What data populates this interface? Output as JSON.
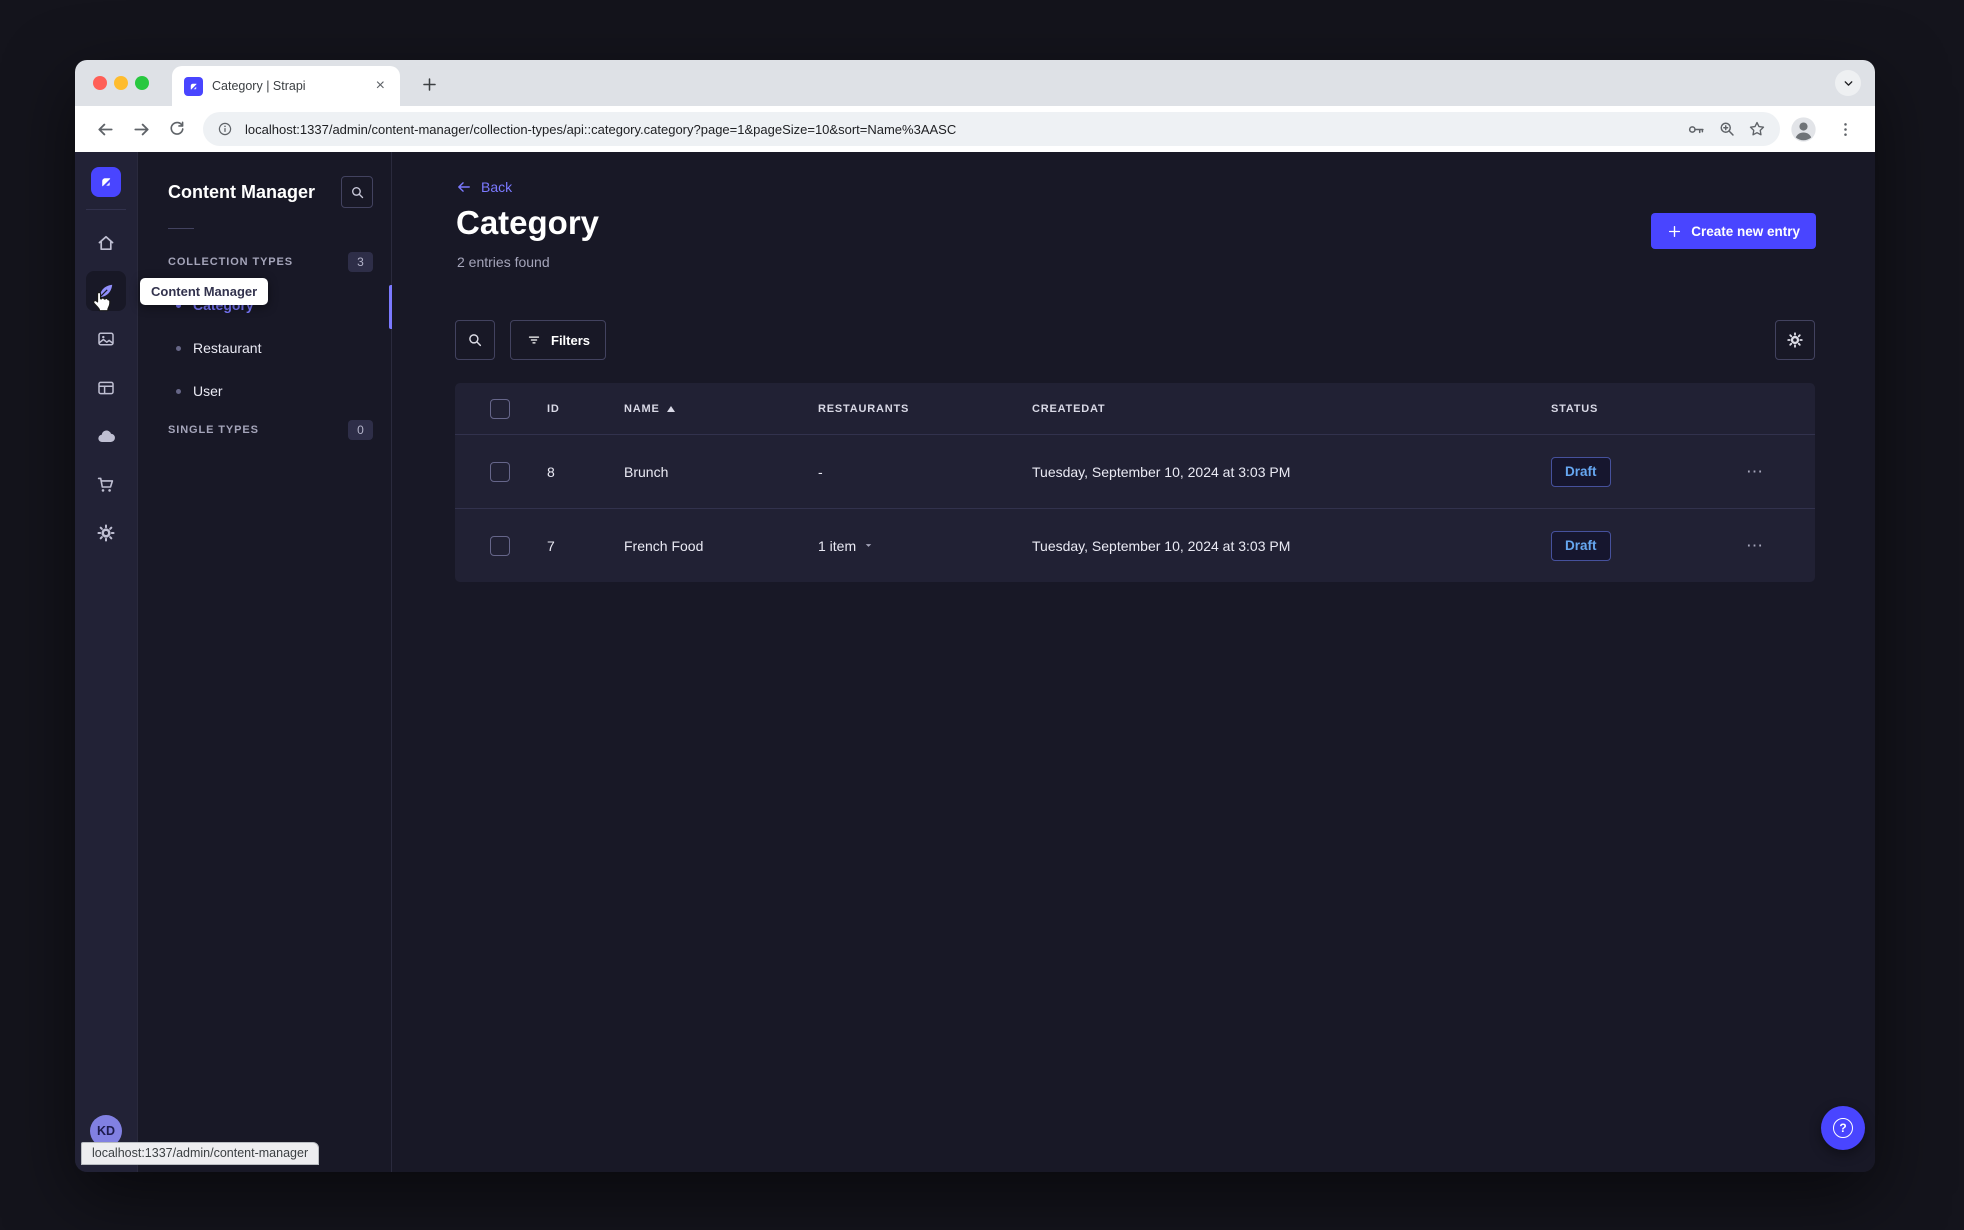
{
  "browser": {
    "tab_title": "Category | Strapi",
    "url": "localhost:1337/admin/content-manager/collection-types/api::category.category?page=1&pageSize=10&sort=Name%3AASC",
    "status_bubble": "localhost:1337/admin/content-manager"
  },
  "icon_rail": {
    "icons": [
      "strapi-logo",
      "home",
      "content-manager",
      "media-library",
      "content-type-builder",
      "cloud",
      "marketplace",
      "settings"
    ],
    "avatar_initials": "KD"
  },
  "subnav": {
    "title": "Content Manager",
    "tooltip": "Content Manager",
    "sections": [
      {
        "label": "COLLECTION TYPES",
        "count": "3",
        "items": [
          {
            "label": "Category",
            "active": true
          },
          {
            "label": "Restaurant",
            "active": false
          },
          {
            "label": "User",
            "active": false
          }
        ]
      },
      {
        "label": "SINGLE TYPES",
        "count": "0",
        "items": []
      }
    ]
  },
  "main": {
    "back_label": "Back",
    "title": "Category",
    "subtitle": "2 entries found",
    "create_button": "Create new entry",
    "filters_button": "Filters",
    "table": {
      "headers": {
        "id": "ID",
        "name": "NAME",
        "restaurants": "RESTAURANTS",
        "createdat": "CREATEDAT",
        "status": "STATUS"
      },
      "rows": [
        {
          "id": "8",
          "name": "Brunch",
          "restaurants": "-",
          "createdat": "Tuesday, September 10, 2024 at 3:03 PM",
          "status": "Draft"
        },
        {
          "id": "7",
          "name": "French Food",
          "restaurants": "1 item",
          "createdat": "Tuesday, September 10, 2024 at 3:03 PM",
          "status": "Draft"
        }
      ]
    }
  },
  "colors": {
    "primary": "#4945ff",
    "primary_light": "#7b79ff",
    "draft_text": "#66a7f1",
    "bg_dark": "#181826",
    "surface": "#212134"
  }
}
